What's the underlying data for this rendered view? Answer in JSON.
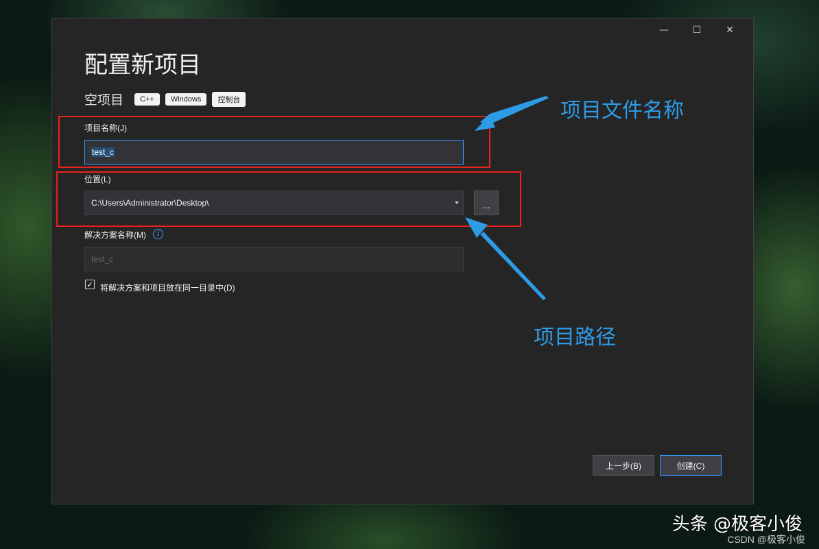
{
  "window": {
    "minimize_glyph": "—",
    "maximize_glyph": "☐",
    "close_glyph": "✕"
  },
  "dialog": {
    "title": "配置新项目",
    "template_name": "空项目",
    "tags": [
      "C++",
      "Windows",
      "控制台"
    ]
  },
  "project_name": {
    "label": "项目名称(J)",
    "value": "test_c"
  },
  "location": {
    "label": "位置(L)",
    "value": "C:\\Users\\Administrator\\Desktop\\",
    "browse_label": "..."
  },
  "solution_name": {
    "label": "解决方案名称(M)",
    "placeholder": "test_c"
  },
  "same_directory": {
    "label": "将解决方案和项目放在同一目录中(D)",
    "checked": true
  },
  "buttons": {
    "back": "上一步(B)",
    "create": "创建(C)"
  },
  "annotations": {
    "project_file_name": "项目文件名称",
    "project_path": "项目路径"
  },
  "watermark": {
    "main": "头条 @极客小俊",
    "sub": "CSDN @极客小俊"
  },
  "colors": {
    "annotation_blue": "#2e9be6",
    "highlight_red": "#e8221c",
    "focus_blue": "#3399ff",
    "dialog_bg": "#252526"
  }
}
